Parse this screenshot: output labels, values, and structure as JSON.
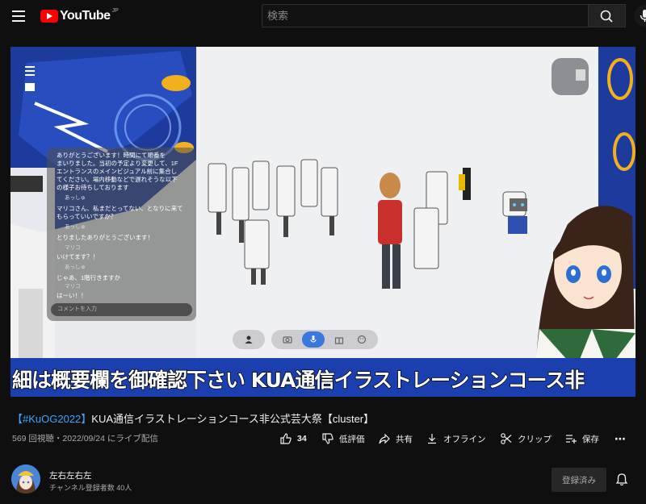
{
  "header": {
    "logo_text": "YouTube",
    "country": "JP",
    "search_placeholder": "検索"
  },
  "video": {
    "subtitle_overlay": "細は概要欄を御確認下さい KUA通信イラストレーションコース非",
    "chat": {
      "lines": [
        {
          "text": "ありがとうございます！時間にて順番を",
          "user": ""
        },
        {
          "text": "まいりました。当初の予定より変更して、1F",
          "user": ""
        },
        {
          "text": "エントランスのメインビジュアル前に集合し",
          "user": ""
        },
        {
          "text": "てください。場内移動などで遅れそうな以下",
          "user": ""
        },
        {
          "text": "の様子お待ちしております",
          "user": ""
        },
        {
          "text": "あっしゅ",
          "user": ""
        },
        {
          "text": "マリコさん、私まだとってない、となりに来て",
          "user": ""
        },
        {
          "text": "もらっていいですか？",
          "user": ""
        },
        {
          "text": "あっしゅ",
          "user": ""
        },
        {
          "text": "とりましたありがとうございます！",
          "user": ""
        },
        {
          "text": "マリコ",
          "user": ""
        },
        {
          "text": "いけてます？！",
          "user": ""
        },
        {
          "text": "あっしゅ",
          "user": ""
        },
        {
          "text": "じゃあ、1階行きますか",
          "user": ""
        },
        {
          "text": "マリコ",
          "user": ""
        },
        {
          "text": "はーい！！",
          "user": ""
        }
      ],
      "input_placeholder": "コメントを入力"
    }
  },
  "title": {
    "hashtag": "【#KuOG2022】",
    "text": "KUA通信イラストレーションコース非公式芸大祭【cluster】"
  },
  "meta": {
    "views_date": "569 回視聴・2022/09/24 にライブ配信"
  },
  "actions": {
    "like_count": "34",
    "dislike_label": "低評価",
    "share_label": "共有",
    "offline_label": "オフライン",
    "clip_label": "クリップ",
    "save_label": "保存",
    "more_label": "⋯"
  },
  "channel": {
    "name": "左右左右左",
    "subscribers": "チャンネル登録者数 40人",
    "subscribe_label": "登録済み"
  },
  "colors": {
    "background": "#0f0f0f",
    "accent_red": "#ff0000",
    "link_blue": "#3ea6ff",
    "subtitle_bar": "#1b3faf"
  }
}
